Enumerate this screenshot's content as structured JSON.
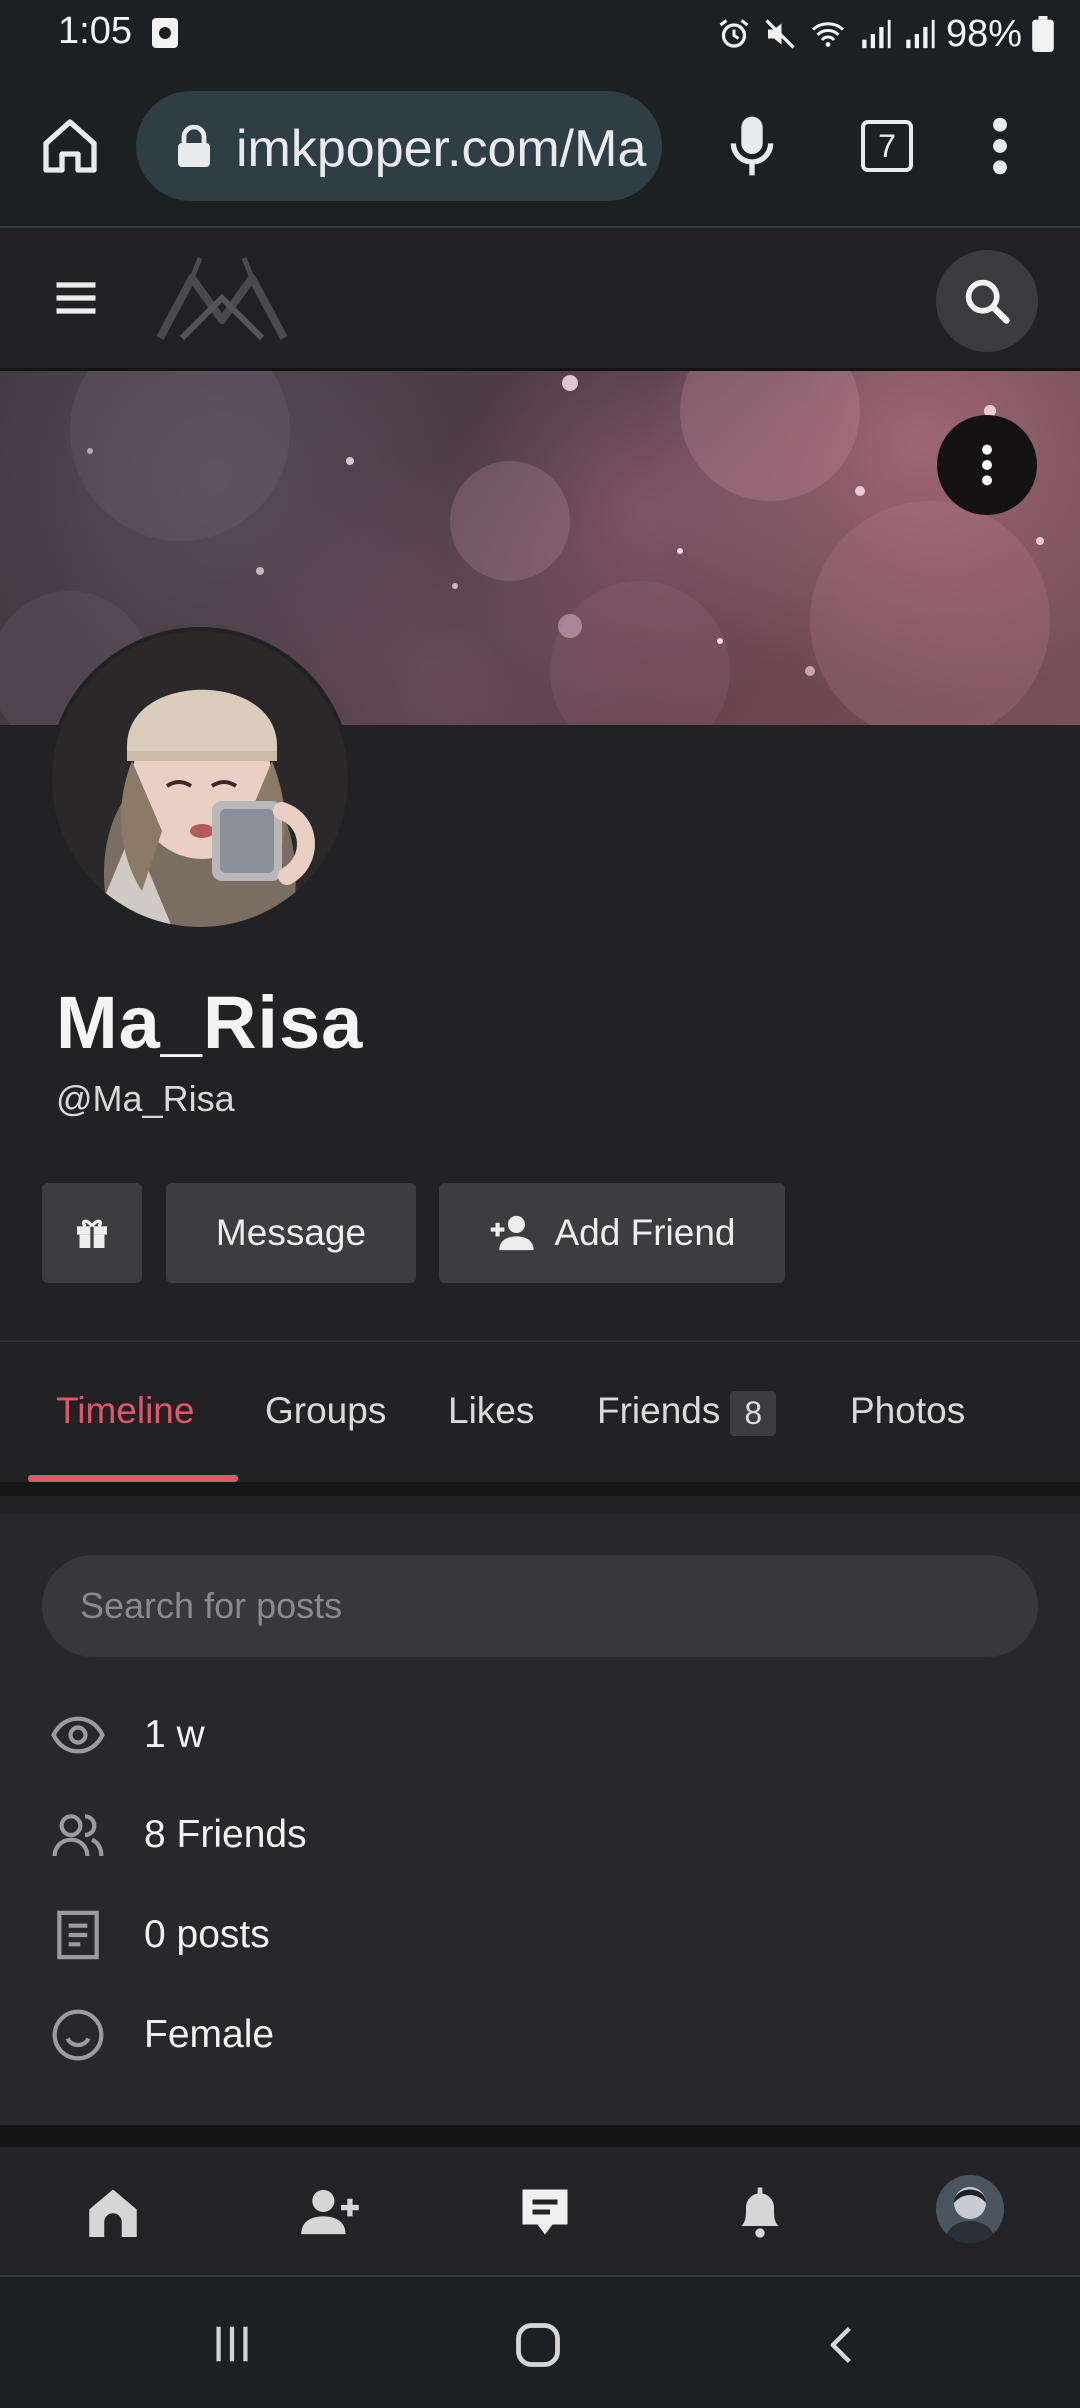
{
  "status_bar": {
    "time": "1:05",
    "battery": "98%"
  },
  "browser": {
    "url": "imkpoper.com/Ma",
    "tab_count": "7"
  },
  "profile": {
    "display_name": "Ma_Risa",
    "handle": "@Ma_Risa",
    "buttons": {
      "message": "Message",
      "add_friend": "Add Friend"
    }
  },
  "tabs": [
    {
      "label": "Timeline",
      "active": true
    },
    {
      "label": "Groups"
    },
    {
      "label": "Likes"
    },
    {
      "label": "Friends",
      "badge": "8"
    },
    {
      "label": "Photos"
    }
  ],
  "posts_search": {
    "placeholder": "Search for posts"
  },
  "info": {
    "views": "1 w",
    "friends": "8 Friends",
    "posts": "0 posts",
    "gender": "Female"
  },
  "colors": {
    "accent": "#e0566a",
    "background": "#222224"
  }
}
